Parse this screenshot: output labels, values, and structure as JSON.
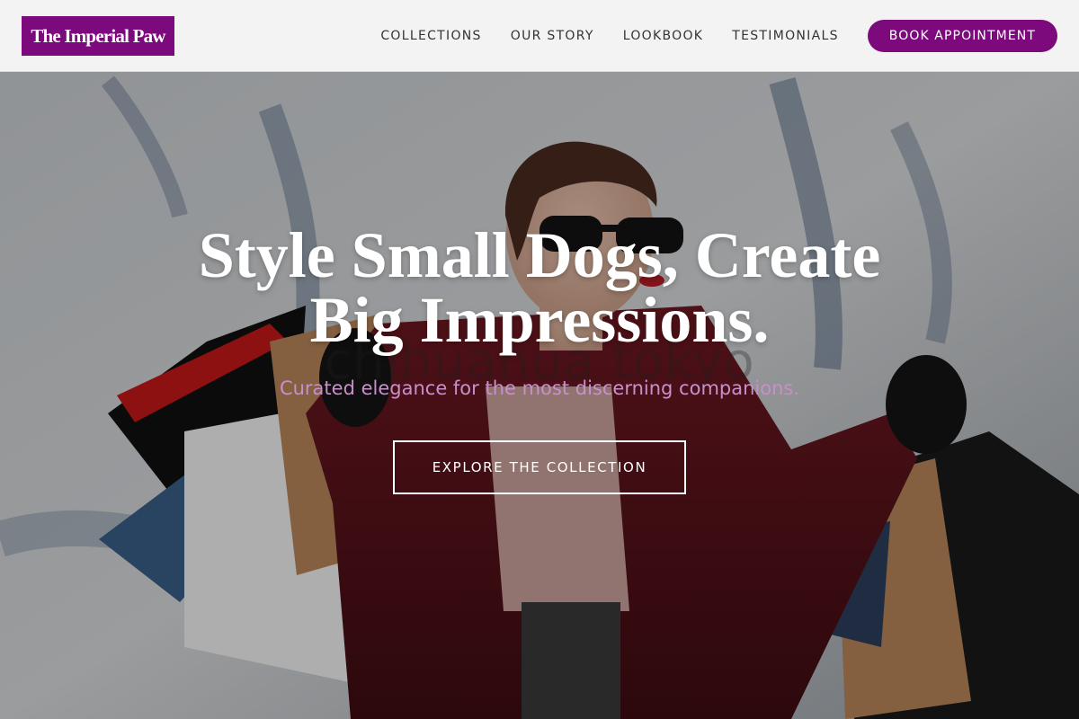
{
  "brand": {
    "name": "The Imperial Paw",
    "color": "#7c0a7c"
  },
  "nav": {
    "items": [
      {
        "label": "COLLECTIONS"
      },
      {
        "label": "OUR STORY"
      },
      {
        "label": "LOOKBOOK"
      },
      {
        "label": "TESTIMONIALS"
      }
    ],
    "cta_label": "BOOK APPOINTMENT"
  },
  "hero": {
    "title_line1": "Style Small Dogs, Create",
    "title_line2": "Big Impressions.",
    "subtitle": "Curated elegance for the most discerning companions.",
    "button_label": "EXPLORE THE COLLECTION",
    "watermark": "chihuahua tokyo",
    "image_icon": "woman-with-shopping-bags-photo"
  }
}
